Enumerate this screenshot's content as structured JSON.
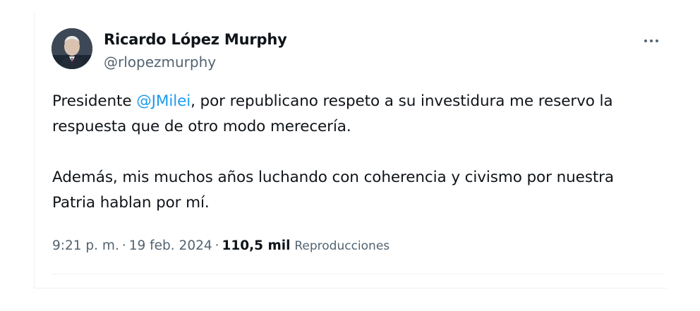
{
  "user": {
    "display_name": "Ricardo López Murphy",
    "handle": "@rlopezmurphy"
  },
  "tweet": {
    "paragraph1_prefix": "Presidente ",
    "mention": "@JMilei",
    "paragraph1_suffix": ", por republicano respeto a su investidura me reservo la respuesta que de otro modo merecería.",
    "paragraph2": "Además, mis muchos años luchando con coherencia y civismo por nuestra Patria hablan por mí."
  },
  "meta": {
    "time": "9:21 p. m.",
    "separator": "·",
    "date": "19 feb. 2024",
    "views_count": "110,5 mil",
    "views_label": "Reproducciones"
  },
  "icons": {
    "more": "more-horizontal-icon",
    "avatar": "profile-photo"
  },
  "colors": {
    "link": "#1d9bf0",
    "secondary_text": "#536471",
    "primary_text": "#0f1419"
  }
}
